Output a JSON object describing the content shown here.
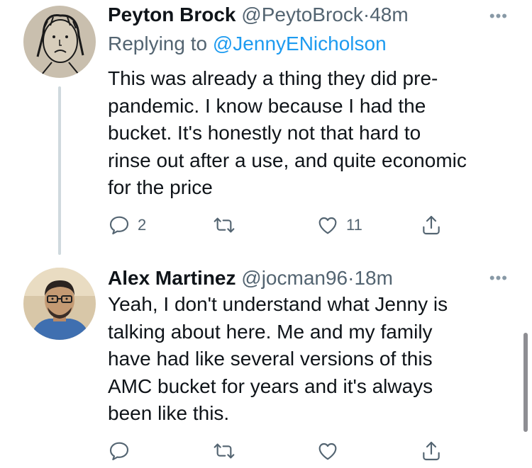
{
  "tweets": [
    {
      "name": "Peyton Brock",
      "handle": "@PeytoBrock",
      "separator": "·",
      "time": "48m",
      "more": "•••",
      "replying_label": "Replying to",
      "replying_to": "@JennyENicholson",
      "text_lines": [
        "This was already a thing they did pre-",
        "pandemic. I know because I had the",
        "bucket. It's honestly not that hard to",
        "rinse out after a use, and quite economic",
        "for the price"
      ],
      "reply_count": "2",
      "retweet_count": "",
      "like_count": "11"
    },
    {
      "name": "Alex Martinez",
      "handle": "@jocman96",
      "separator": "·",
      "time": "18m",
      "more": "•••",
      "text_lines": [
        "Yeah, I don't understand what Jenny is",
        "talking about here. Me and my family",
        "have had like several versions of this",
        "AMC bucket for years and it's always",
        "been like this."
      ],
      "reply_count": "",
      "retweet_count": "",
      "like_count": ""
    }
  ],
  "icons": {
    "reply": "reply-icon",
    "retweet": "retweet-icon",
    "like": "heart-icon",
    "share": "share-icon"
  },
  "colors": {
    "text": "#0f1419",
    "secondary": "#536471",
    "accent": "#1d9bf0",
    "thread_line": "#cfd9de"
  }
}
